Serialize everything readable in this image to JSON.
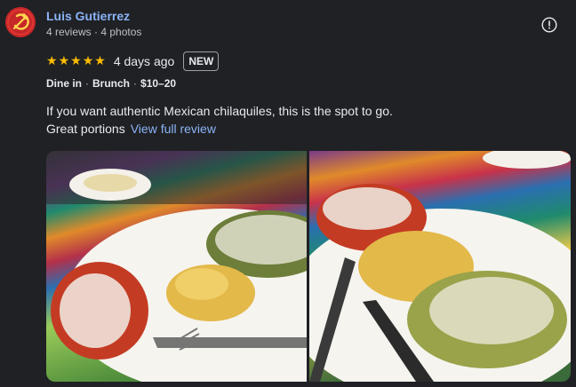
{
  "author": {
    "name": "Luis Gutierrez",
    "stats": "4 reviews · 4 photos"
  },
  "rating": {
    "stars": 5,
    "max": 5,
    "time_ago": "4 days ago",
    "badge": "NEW"
  },
  "attributes": [
    "Dine in",
    "Brunch",
    "$10–20"
  ],
  "review": {
    "line1": "If you want authentic Mexican chilaquiles, this is the spot to go.",
    "line2": "Great portions",
    "more_link": "View full review"
  },
  "icons": {
    "avatar": "hammer-sickle-icon",
    "report": "exclamation-circle-icon",
    "star": "star-icon"
  },
  "colors": {
    "background": "#202124",
    "link": "#8ab4f8",
    "star": "#fbbc04",
    "avatar": "#c62828"
  }
}
